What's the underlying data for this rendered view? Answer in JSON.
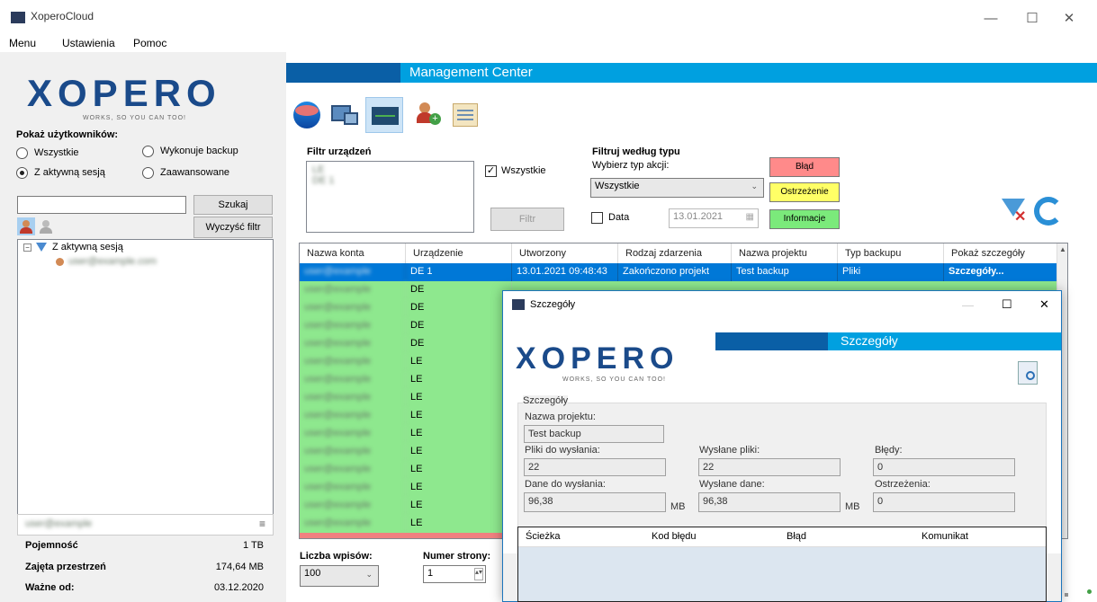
{
  "window": {
    "title": "XoperoCloud",
    "minimize": "—",
    "maximize": "☐",
    "close": "✕"
  },
  "menu": {
    "items": [
      "Menu",
      "Ustawienia",
      "Pomoc"
    ]
  },
  "logo": {
    "text": "XOPERO",
    "tagline": "WORKS, SO YOU CAN TOO!"
  },
  "users": {
    "heading": "Pokaż użytkowników:",
    "options": [
      "Wszystkie",
      "Wykonuje backup",
      "Z aktywną sesją",
      "Zaawansowane"
    ],
    "selected": "Z aktywną sesją",
    "search_value": "",
    "search_button": "Szukaj",
    "clear_button": "Wyczyść filtr",
    "tree_root": "Z aktywną sesją",
    "tree_child": "user@example.com"
  },
  "storage": {
    "account": "user@example",
    "rows": [
      {
        "label": "Pojemność",
        "value": "1 TB"
      },
      {
        "label": "Zajęta przestrzeń",
        "value": "174,64 MB"
      },
      {
        "label": "Ważne od:",
        "value": "03.12.2020"
      }
    ]
  },
  "header": {
    "title": "Management Center"
  },
  "filters": {
    "devices_label": "Filtr urządzeń",
    "devices": [
      "LE",
      "DE                    1"
    ],
    "all_checkbox": "Wszystkie",
    "filter_button": "Filtr",
    "type_label": "Filtruj według typu",
    "action_label": "Wybierz typ akcji:",
    "action_value": "Wszystkie",
    "date_checkbox": "Data",
    "date_value": "13.01.2021",
    "error_btn": "Błąd",
    "warning_btn": "Ostrzeżenie",
    "info_btn": "Informacje"
  },
  "grid": {
    "columns": [
      "Nazwa konta",
      "Urządzenie",
      "Utworzony",
      "Rodzaj zdarzenia",
      "Nazwa projektu",
      "Typ backupu",
      "Pokaż szczegóły"
    ],
    "selected_row": {
      "account": "user@example",
      "device": "DE                 1",
      "created": "13.01.2021 09:48:43",
      "event": "Zakończono projekt",
      "project": "Test backup",
      "type": "Pliki",
      "details": "Szczegóły..."
    },
    "green_devices": [
      "DE",
      "DE",
      "DE",
      "DE",
      "LE",
      "LE",
      "LE",
      "LE",
      "LE",
      "LE",
      "LE",
      "LE",
      "LE",
      "LE",
      "LE"
    ],
    "row_colors": {
      "selected": "#0078d7",
      "success": "#8ee88e",
      "error": "#f08080"
    }
  },
  "pagination": {
    "entries_label": "Liczba wpisów:",
    "entries_value": "100",
    "page_label": "Numer strony:",
    "page_value": "1"
  },
  "dialog": {
    "title": "Szczegóły",
    "banner": "Szczegóły",
    "group_label": "Szczegóły",
    "project_label": "Nazwa projektu:",
    "project_value": "Test backup",
    "files_to_send_label": "Pliki do wysłania:",
    "files_to_send_value": "22",
    "files_sent_label": "Wysłane pliki:",
    "files_sent_value": "22",
    "errors_label": "Błędy:",
    "errors_value": "0",
    "data_to_send_label": "Dane do wysłania:",
    "data_to_send_value": "96,38",
    "data_unit": "MB",
    "data_sent_label": "Wysłane dane:",
    "data_sent_value": "96,38",
    "data_sent_unit": "MB",
    "warnings_label": "Ostrzeżenia:",
    "warnings_value": "0",
    "table_columns": [
      "Ścieżka",
      "Kod błędu",
      "Błąd",
      "Komunikat"
    ]
  }
}
